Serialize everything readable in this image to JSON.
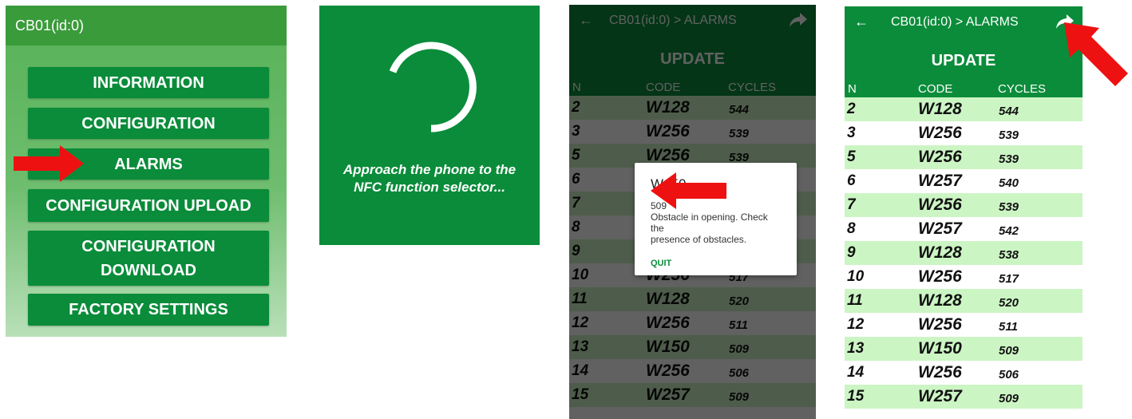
{
  "menu_screen": {
    "title": "CB01(id:0)",
    "buttons": [
      {
        "label": "INFORMATION"
      },
      {
        "label": "CONFIGURATION"
      },
      {
        "label": "ALARMS"
      },
      {
        "label": "CONFIGURATION UPLOAD"
      },
      {
        "label": "CONFIGURATION\nDOWNLOAD"
      },
      {
        "label": "FACTORY SETTINGS"
      }
    ]
  },
  "nfc_screen": {
    "message_line1": "Approach the phone to the",
    "message_line2": "NFC function selector..."
  },
  "alarms_screen": {
    "back_icon": "←",
    "breadcrumb": "CB01(id:0) > ALARMS",
    "update_label": "UPDATE",
    "columns": {
      "n": "N",
      "code": "CODE",
      "cycles": "CYCLES"
    },
    "rows": [
      {
        "n": "2",
        "code": "W128",
        "cycles": "544"
      },
      {
        "n": "3",
        "code": "W256",
        "cycles": "539"
      },
      {
        "n": "5",
        "code": "W256",
        "cycles": "539"
      },
      {
        "n": "6",
        "code": "W257",
        "cycles": "540"
      },
      {
        "n": "7",
        "code": "W256",
        "cycles": "539"
      },
      {
        "n": "8",
        "code": "W257",
        "cycles": "542"
      },
      {
        "n": "9",
        "code": "W128",
        "cycles": "538"
      },
      {
        "n": "10",
        "code": "W256",
        "cycles": "517"
      },
      {
        "n": "11",
        "code": "W128",
        "cycles": "520"
      },
      {
        "n": "12",
        "code": "W256",
        "cycles": "511"
      },
      {
        "n": "13",
        "code": "W150",
        "cycles": "509"
      },
      {
        "n": "14",
        "code": "W256",
        "cycles": "506"
      },
      {
        "n": "15",
        "code": "W257",
        "cycles": "509"
      }
    ]
  },
  "alarm_dialog": {
    "title": "W150",
    "number": "509",
    "description_line1": "Obstacle in opening. Check the",
    "description_line2": "presence of obstacles.",
    "quit_label": "QUIT"
  },
  "colors": {
    "brand_green": "#0a8c3a",
    "row_highlight": "#ccf5c4",
    "arrow_red": "#ee1111"
  }
}
